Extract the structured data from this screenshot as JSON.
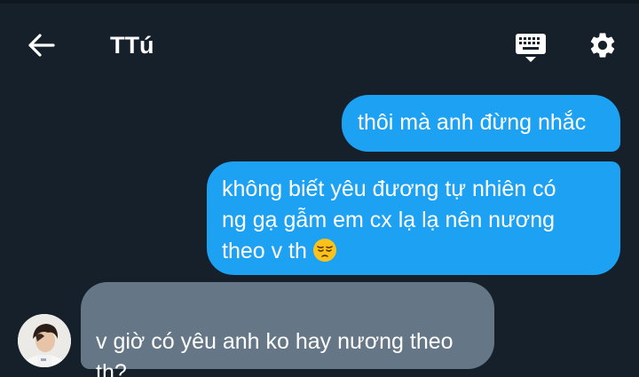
{
  "header": {
    "title": "TTú",
    "back_icon": "arrow-left-icon",
    "keyboard_icon": "keyboard-icon",
    "settings_icon": "gear-icon"
  },
  "messages": [
    {
      "direction": "outgoing",
      "text": "thôi mà anh đừng nhắc"
    },
    {
      "direction": "outgoing",
      "text": "không biết yêu đương tự nhiên có\nng gạ gẫm em cx lạ lạ nên nương\ntheo v th",
      "emoji": "pensive-face"
    },
    {
      "direction": "incoming",
      "text": "v giờ có yêu anh ko hay nương theo\nth?",
      "avatar": "contact-avatar"
    }
  ],
  "colors": {
    "background": "#15202b",
    "outgoing_bubble": "#1da1f2",
    "incoming_bubble": "#657786",
    "text": "#ffffff"
  }
}
